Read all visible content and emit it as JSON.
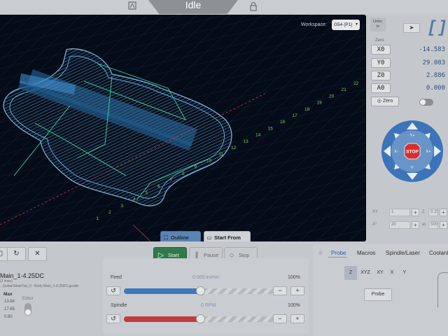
{
  "header": {
    "state": "Idle",
    "left_icon": "probe-icon",
    "right_icon": "lock-icon"
  },
  "visualizer": {
    "workspace_label": "Workspace:",
    "workspace_value": "G54 (P1)",
    "outline_button": "Outline",
    "start_from_button": "Start From",
    "grid_numbers": [
      "22",
      "21",
      "20",
      "19",
      "18",
      "17",
      "16",
      "15",
      "14",
      "13",
      "12",
      "11",
      "10",
      "9",
      "8",
      "7",
      "6",
      "5",
      "4",
      "3",
      "2",
      "1"
    ]
  },
  "right_panel": {
    "units_label": "Units:",
    "units_value": "in",
    "send_icon": "send-icon",
    "zero_label": "Zero",
    "axes": [
      {
        "label": "X0",
        "value": "-14.583"
      },
      {
        "label": "Y0",
        "value": "29.083"
      },
      {
        "label": "Z0",
        "value": "2.886"
      },
      {
        "label": "A0",
        "value": "0.000"
      }
    ],
    "zero_button": "Zero",
    "jog": {
      "stop_label": "STOP",
      "x_minus": "X-",
      "x_plus": "X+",
      "y_plus": "Y+",
      "y_minus": "Y-"
    },
    "step_xy_label": "XY",
    "step_xy_value": "1",
    "step_z_label": "Z",
    "step_z_value": "0.25",
    "step_a_label": "A°",
    "step_a_value": "20",
    "step_at_label": "at",
    "step_at_value": "500"
  },
  "file": {
    "name": "Main_1-4.25DC",
    "size": "(2 lines)",
    "path": "...Guitar\\Strat\\Top_0 - Body Main_1-4.25DC.gcode",
    "max_label": "Max",
    "max_values": [
      "13.84",
      "17.65",
      "0.80"
    ],
    "editor_label": "Editor"
  },
  "job": {
    "start": "Start",
    "pause": "Pause",
    "stop": "Stop"
  },
  "overrides": {
    "feed_label": "Feed",
    "feed_value": "0.000 in/min",
    "feed_percent": "100%",
    "feed_level": 0.5,
    "spindle_label": "Spindle",
    "spindle_value": "0 RPM",
    "spindle_percent": "100%",
    "spindle_level": 0.5
  },
  "tools": {
    "tabs": [
      "Probe",
      "Macros",
      "Spindle/Laser",
      "Coolant"
    ],
    "axis_options": [
      "Z",
      "XYZ",
      "XY",
      "X",
      "Y"
    ],
    "probe_button": "Probe"
  },
  "colors": {
    "visualizer_bg": "#050c18",
    "model_blue": "#3a8fd0",
    "toolpath_green": "#3ad9a0",
    "start_green": "#2f7a4a",
    "stop_red": "#d62f2f",
    "jog_blue": "#3d73b8"
  }
}
